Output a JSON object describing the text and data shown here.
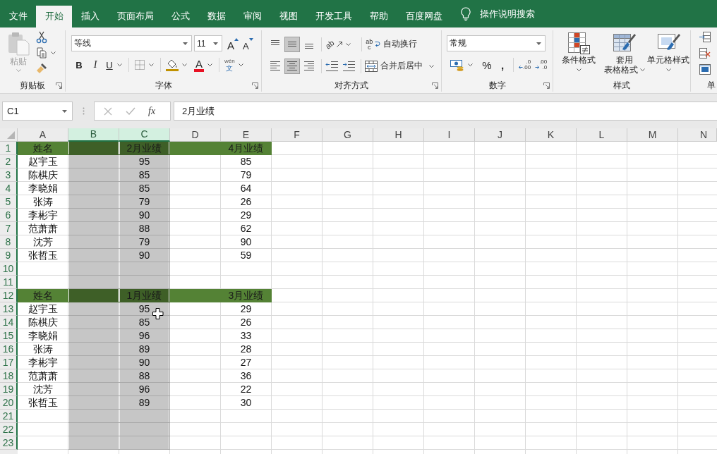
{
  "menu_tabs": [
    {
      "label": "文件",
      "selected": false
    },
    {
      "label": "开始",
      "selected": true
    },
    {
      "label": "插入",
      "selected": false
    },
    {
      "label": "页面布局",
      "selected": false
    },
    {
      "label": "公式",
      "selected": false
    },
    {
      "label": "数据",
      "selected": false
    },
    {
      "label": "审阅",
      "selected": false
    },
    {
      "label": "视图",
      "selected": false
    },
    {
      "label": "开发工具",
      "selected": false
    },
    {
      "label": "帮助",
      "selected": false
    },
    {
      "label": "百度网盘",
      "selected": false
    }
  ],
  "tell_me": {
    "label": "操作说明搜索"
  },
  "ribbon": {
    "clipboard": {
      "label": "剪贴板",
      "paste": {
        "label": "粘贴",
        "disabled": true
      }
    },
    "font": {
      "label": "字体",
      "font_name": "等线",
      "font_size": "11",
      "grow_font": "A",
      "shrink_font": "A",
      "bold": "B",
      "italic": "I",
      "underline": "U",
      "font_color": "A",
      "phonetic": {
        "top": "wén",
        "bottom": "文"
      }
    },
    "alignment": {
      "label": "对齐方式",
      "vertical": [
        {
          "kind": "top",
          "selected": false
        },
        {
          "kind": "middle",
          "selected": true
        },
        {
          "kind": "bottom",
          "selected": false
        }
      ],
      "horizontal": [
        {
          "kind": "left",
          "selected": false
        },
        {
          "kind": "center",
          "selected": true
        },
        {
          "kind": "right",
          "selected": false
        }
      ],
      "orientation": "ab",
      "wrap_text": {
        "glyph_top": "ab",
        "glyph_bottom": "c",
        "label": "自动换行"
      },
      "merge": "合并后居中"
    },
    "number": {
      "label": "数字",
      "format": "常规",
      "percent": "%",
      "comma": ",",
      "increase_decimal": {
        "top": ".0",
        "bottom": ".00"
      },
      "decrease_decimal": {
        "top": ".00",
        "bottom": ".0"
      }
    },
    "styles": {
      "label": "样式",
      "buttons": [
        {
          "kind": "conditional",
          "lines": [
            "条件格式"
          ]
        },
        {
          "kind": "table",
          "lines": [
            "套用",
            "表格格式"
          ]
        },
        {
          "kind": "cell",
          "lines": [
            "单元格样式"
          ]
        }
      ]
    },
    "cells": {
      "label": "单"
    }
  },
  "formula_bar": {
    "name_box": "C1",
    "cancel": {
      "disabled": true
    },
    "enter": {
      "disabled": true
    },
    "function_button": "fx",
    "formula": "2月业绩"
  },
  "sheet": {
    "columns": [
      {
        "label": "A",
        "selected": false
      },
      {
        "label": "B",
        "selected": true
      },
      {
        "label": "C",
        "selected": true
      },
      {
        "label": "D",
        "selected": false
      },
      {
        "label": "E",
        "selected": false
      },
      {
        "label": "F",
        "selected": false
      },
      {
        "label": "G",
        "selected": false
      },
      {
        "label": "H",
        "selected": false
      },
      {
        "label": "I",
        "selected": false
      },
      {
        "label": "J",
        "selected": false
      },
      {
        "label": "K",
        "selected": false
      },
      {
        "label": "L",
        "selected": false
      },
      {
        "label": "M",
        "selected": false
      },
      {
        "label": "N",
        "selected": false
      }
    ],
    "rows": [
      {
        "label": "1",
        "kind": "header",
        "cells": {
          "A": "姓名",
          "C": "2月业绩",
          "E": "4月业绩"
        }
      },
      {
        "label": "2",
        "kind": "data",
        "cells": {
          "A": "赵宇玉",
          "C": "95",
          "E": "85"
        }
      },
      {
        "label": "3",
        "kind": "data",
        "cells": {
          "A": "陈棋庆",
          "C": "85",
          "E": "79"
        }
      },
      {
        "label": "4",
        "kind": "data",
        "cells": {
          "A": "李晓娟",
          "C": "85",
          "E": "64"
        }
      },
      {
        "label": "5",
        "kind": "data",
        "cells": {
          "A": "张涛",
          "C": "79",
          "E": "26"
        }
      },
      {
        "label": "6",
        "kind": "data",
        "cells": {
          "A": "李彬宇",
          "C": "90",
          "E": "29"
        }
      },
      {
        "label": "7",
        "kind": "data",
        "cells": {
          "A": "范萧萧",
          "C": "88",
          "E": "62"
        }
      },
      {
        "label": "8",
        "kind": "data",
        "cells": {
          "A": "沈芳",
          "C": "79",
          "E": "90"
        }
      },
      {
        "label": "9",
        "kind": "data",
        "cells": {
          "A": "张哲玉",
          "C": "90",
          "E": "59"
        }
      },
      {
        "label": "10",
        "kind": "data"
      },
      {
        "label": "11",
        "kind": "data"
      },
      {
        "label": "12",
        "kind": "header",
        "cells": {
          "A": "姓名",
          "C": "1月业绩",
          "E": "3月业绩"
        }
      },
      {
        "label": "13",
        "kind": "data",
        "cells": {
          "A": "赵宇玉",
          "C": "95",
          "E": "29"
        }
      },
      {
        "label": "14",
        "kind": "data",
        "cells": {
          "A": "陈棋庆",
          "C": "85",
          "E": "26"
        }
      },
      {
        "label": "15",
        "kind": "data",
        "cells": {
          "A": "李晓娟",
          "C": "96",
          "E": "33"
        }
      },
      {
        "label": "16",
        "kind": "data",
        "cells": {
          "A": "张涛",
          "C": "89",
          "E": "28"
        }
      },
      {
        "label": "17",
        "kind": "data",
        "cells": {
          "A": "李彬宇",
          "C": "90",
          "E": "27"
        }
      },
      {
        "label": "18",
        "kind": "data",
        "cells": {
          "A": "范萧萧",
          "C": "88",
          "E": "36"
        }
      },
      {
        "label": "19",
        "kind": "data",
        "cells": {
          "A": "沈芳",
          "C": "96",
          "E": "22"
        }
      },
      {
        "label": "20",
        "kind": "data",
        "cells": {
          "A": "张哲玉",
          "C": "89",
          "E": "30"
        }
      },
      {
        "label": "21",
        "kind": "data"
      },
      {
        "label": "22",
        "kind": "data"
      },
      {
        "label": "23",
        "kind": "data"
      }
    ]
  }
}
